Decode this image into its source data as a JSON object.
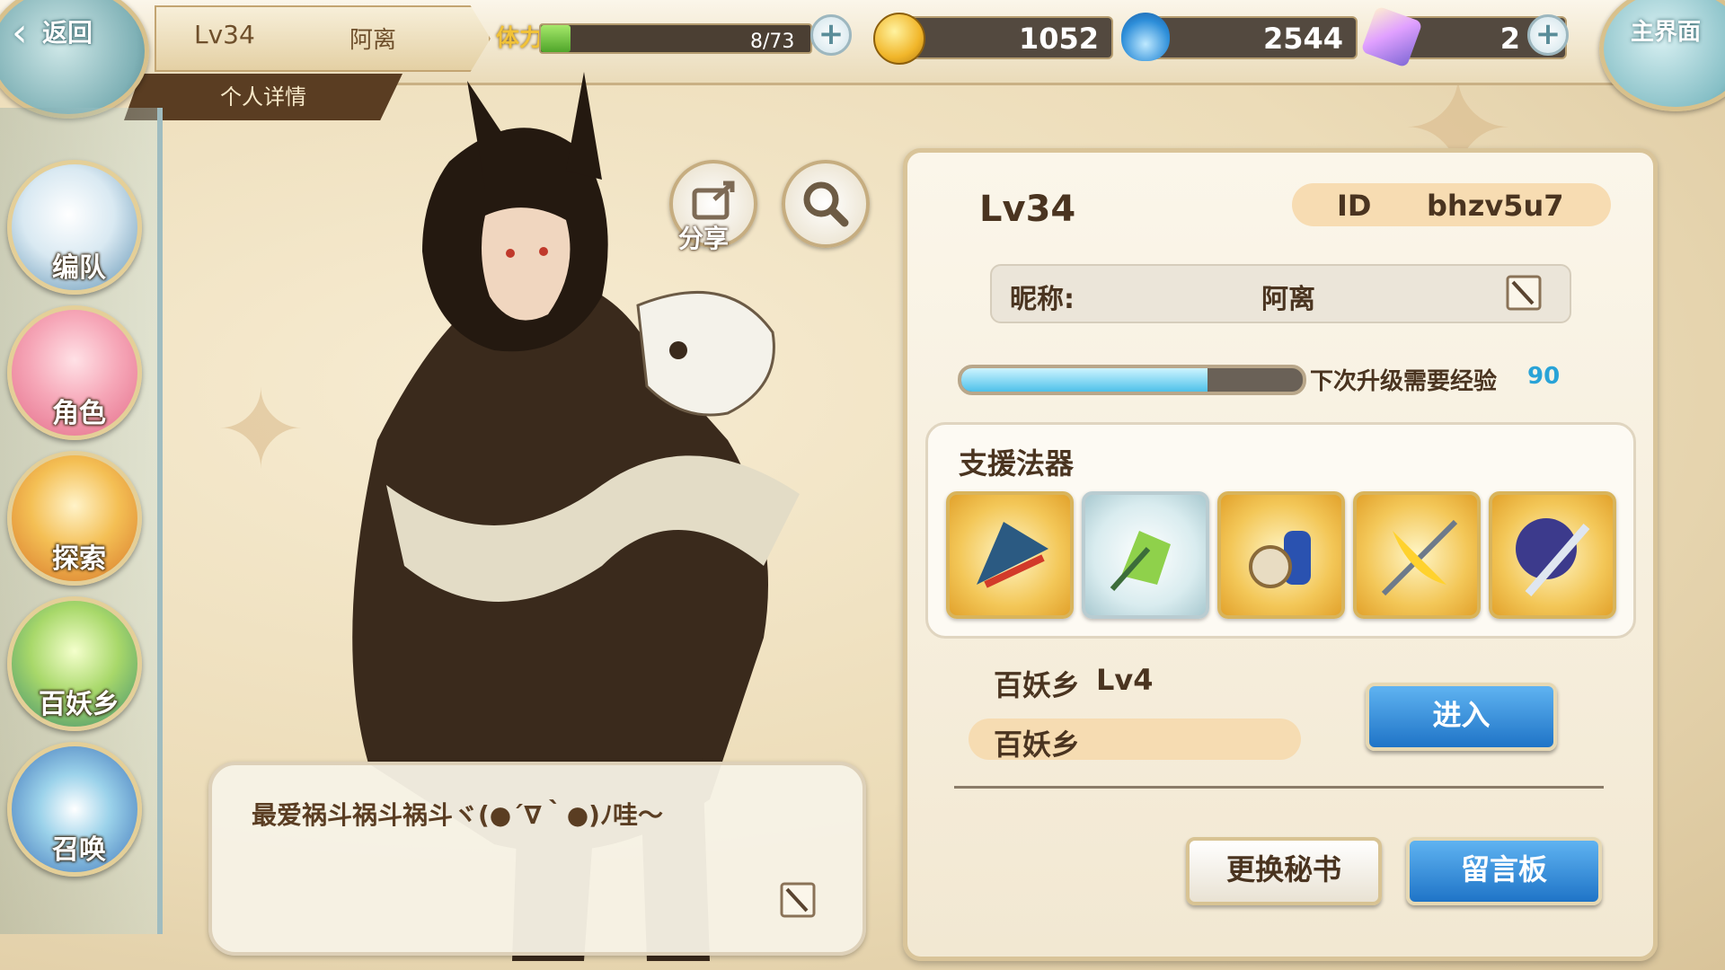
{
  "top_bar": {
    "back_label": "返回",
    "level": "Lv34",
    "player_name": "阿离",
    "stamina_label": "体力",
    "stamina_value": "8/73",
    "stamina_fraction": 0.11,
    "gold": "1052",
    "soul_fire": "2544",
    "crystal": "2",
    "home_label": "主界面"
  },
  "detail_tab": "个人详情",
  "sidebar": {
    "items": [
      {
        "label": "编队"
      },
      {
        "label": "角色"
      },
      {
        "label": "探索"
      },
      {
        "label": "百妖乡"
      },
      {
        "label": "召唤"
      }
    ]
  },
  "character": {
    "share_label": "分享",
    "speech": "最爱祸斗祸斗祸斗ヾ(●´∇｀●)ﾉ哇～"
  },
  "profile": {
    "level": "Lv34",
    "id_label": "ID",
    "id_value": "bhzv5u7",
    "nickname_label": "昵称:",
    "nickname": "阿离",
    "exp_label": "下次升级需要经验",
    "exp_value": "90",
    "exp_fraction": 0.72,
    "artifact_title": "支援法器",
    "artifacts": [
      {
        "name": "fan-artifact-icon"
      },
      {
        "name": "green-chime-artifact-icon"
      },
      {
        "name": "scroll-artifact-icon"
      },
      {
        "name": "golden-spear-artifact-icon"
      },
      {
        "name": "spirit-sword-artifact-icon"
      }
    ],
    "village_label": "百妖乡",
    "village_level": "Lv4",
    "village_sub": "百妖乡",
    "enter_button": "进入",
    "change_secretary_button": "更换秘书",
    "message_board_button": "留言板"
  }
}
